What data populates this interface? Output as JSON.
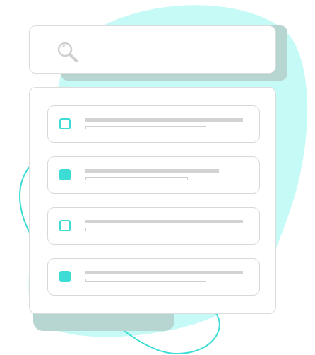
{
  "search": {
    "placeholder": "",
    "value": "",
    "icon": "search-icon"
  },
  "list": {
    "items": [
      {
        "checked": false
      },
      {
        "checked": true
      },
      {
        "checked": false
      },
      {
        "checked": true
      }
    ]
  },
  "colors": {
    "accent": "#3ddcd4",
    "blob": "#c6faf6",
    "shadow": "#b8d6d1",
    "outline": "#3ddcd4",
    "border": "#dcdcdc",
    "placeholder_line": "#d2d2d2"
  }
}
